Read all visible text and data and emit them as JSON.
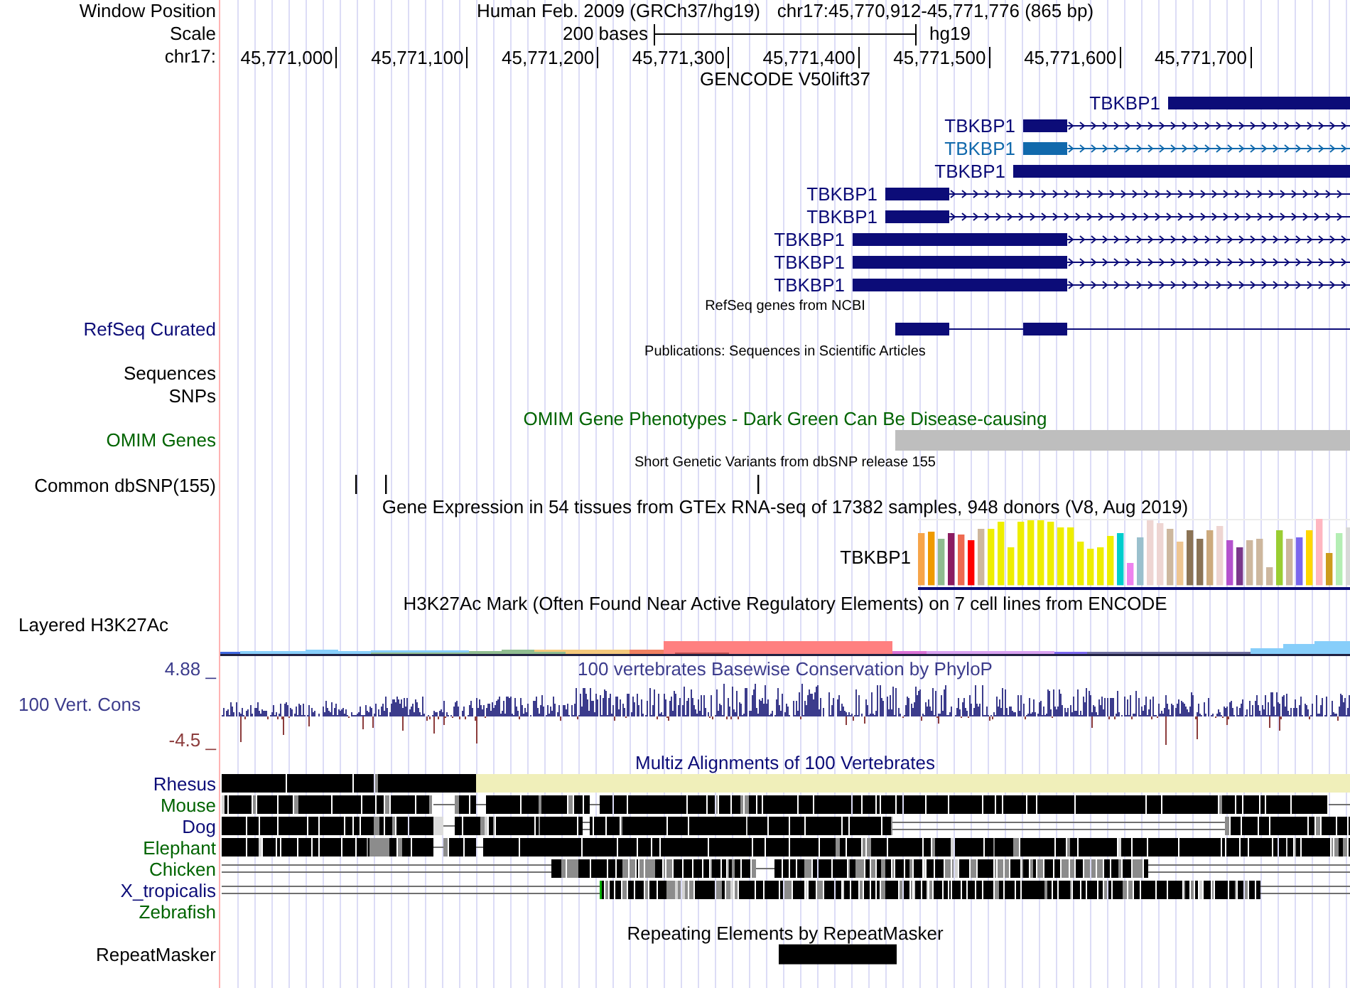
{
  "header": {
    "label": "Window Position",
    "assembly": "Human Feb. 2009 (GRCh37/hg19)",
    "position": "chr17:45,770,912-45,771,776 (865 bp)"
  },
  "scale": {
    "label": "Scale",
    "length": "200 bases",
    "assembly": "hg19"
  },
  "ruler": {
    "label": "chr17:",
    "ticks": [
      "45,771,000",
      "45,771,100",
      "45,771,200",
      "45,771,300",
      "45,771,400",
      "45,771,500",
      "45,771,600",
      "45,771,700"
    ]
  },
  "tracks": [
    {
      "kind": "gencode",
      "title": {
        "text": "GENCODE V50lift37"
      },
      "transcripts": [
        {
          "label": "TBKBP1",
          "color": "#0c0c78"
        },
        {
          "label": "TBKBP1",
          "color": "#0c0c78"
        },
        {
          "label": "TBKBP1",
          "color": "#1169ac"
        },
        {
          "label": "TBKBP1",
          "color": "#0c0c78"
        },
        {
          "label": "TBKBP1",
          "color": "#0c0c78"
        },
        {
          "label": "TBKBP1",
          "color": "#0c0c78"
        },
        {
          "label": "TBKBP1",
          "color": "#0c0c78"
        },
        {
          "label": "TBKBP1",
          "color": "#0c0c78"
        },
        {
          "label": "TBKBP1",
          "color": "#0c0c78"
        }
      ]
    },
    {
      "kind": "refseq",
      "title": {
        "text": "RefSeq genes from NCBI"
      },
      "label": {
        "text": "RefSeq Curated",
        "color": "#0c0c78"
      }
    },
    {
      "kind": "publications",
      "title": {
        "text": "Publications: Sequences in Scientific Articles"
      },
      "subtracks": [
        "Sequences",
        "SNPs"
      ]
    },
    {
      "kind": "omim",
      "title": {
        "text": "OMIM Gene Phenotypes - Dark Green Can Be Disease-causing",
        "color": "#006400"
      },
      "label": {
        "text": "OMIM Genes",
        "color": "#006400"
      }
    },
    {
      "kind": "dbsnp",
      "title": {
        "text": "Short Genetic Variants from dbSNP release 155"
      },
      "label": {
        "text": "Common dbSNP(155)"
      }
    },
    {
      "kind": "gtex",
      "title": {
        "text": "Gene Expression in 54 tissues from GTEx RNA-seq of 17382 samples, 948 donors (V8, Aug 2019)"
      },
      "gene": "TBKBP1"
    },
    {
      "kind": "h3k27ac",
      "title": {
        "text": "H3K27Ac Mark (Often Found Near Active Regulatory Elements) on 7 cell lines from ENCODE"
      },
      "label": {
        "text": "Layered H3K27Ac"
      }
    },
    {
      "kind": "phylop",
      "title": {
        "text": "100 vertebrates Basewise Conservation by PhyloP",
        "color": "#3c3c8c"
      },
      "label": {
        "text": "100 Vert. Cons",
        "color": "#3c3c8c"
      },
      "max_label": {
        "text": "4.88 _",
        "color": "#3c3c8c"
      },
      "min_label": {
        "text": "-4.5 _",
        "color": "#8c3c3c"
      }
    },
    {
      "kind": "multiz",
      "title": {
        "text": "Multiz Alignments of 100 Vertebrates",
        "color": "#0c0c78"
      },
      "species": [
        {
          "name": "Rhesus",
          "color": "#0c0c78"
        },
        {
          "name": "Mouse",
          "color": "#006400"
        },
        {
          "name": "Dog",
          "color": "#0c0c78"
        },
        {
          "name": "Elephant",
          "color": "#006400"
        },
        {
          "name": "Chicken",
          "color": "#006400"
        },
        {
          "name": "X_tropicalis",
          "color": "#0c0c78"
        },
        {
          "name": "Zebrafish",
          "color": "#006400"
        }
      ]
    },
    {
      "kind": "repeatmasker",
      "title": {
        "text": "Repeating Elements by RepeatMasker"
      },
      "label": {
        "text": "RepeatMasker"
      }
    }
  ]
}
